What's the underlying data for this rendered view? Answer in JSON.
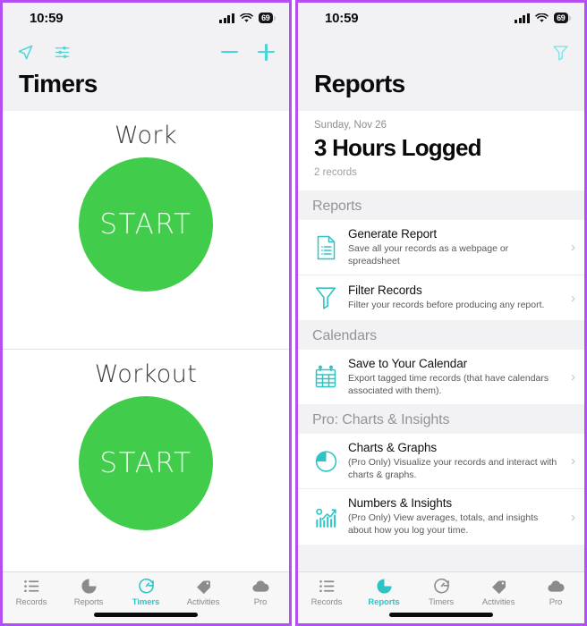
{
  "accent": {
    "teal": "#2ec4c4",
    "teal_light": "#4ad6d6",
    "green": "#41cc4c",
    "frame": "#b44ef5"
  },
  "left_phone": {
    "statusbar": {
      "time": "10:59",
      "battery": "69",
      "signal_icon": "cellular-bars-icon",
      "wifi_icon": "wifi-icon"
    },
    "navbar": {
      "location_icon": "navigation-arrow-icon",
      "filters_icon": "sliders-icon",
      "minus_label": "minus-icon",
      "plus_label": "plus-icon"
    },
    "title": "Timers",
    "timers": [
      {
        "name": "Work",
        "button_label": "START"
      },
      {
        "name": "Workout",
        "button_label": "START"
      }
    ],
    "tabs": [
      {
        "label": "Records",
        "icon": "list-icon",
        "active": false
      },
      {
        "label": "Reports",
        "icon": "pie-chart-icon",
        "active": false
      },
      {
        "label": "Timers",
        "icon": "stopwatch-icon",
        "active": true
      },
      {
        "label": "Activities",
        "icon": "tag-icon",
        "active": false
      },
      {
        "label": "Pro",
        "icon": "cloud-icon",
        "active": false
      }
    ]
  },
  "right_phone": {
    "statusbar": {
      "time": "10:59",
      "battery": "69",
      "signal_icon": "cellular-bars-icon",
      "wifi_icon": "wifi-icon"
    },
    "navbar": {
      "filter_icon": "funnel-icon"
    },
    "title": "Reports",
    "summary": {
      "date": "Sunday, Nov 26",
      "headline": "3 Hours Logged",
      "records": "2 records"
    },
    "sections": [
      {
        "header": "Reports",
        "rows": [
          {
            "icon": "document-report-icon",
            "title": "Generate Report",
            "subtitle": "Save all your records as a webpage or spreadsheet",
            "chevron": "›"
          },
          {
            "icon": "funnel-icon",
            "title": "Filter Records",
            "subtitle": "Filter your records before producing any report.",
            "chevron": "›"
          }
        ]
      },
      {
        "header": "Calendars",
        "rows": [
          {
            "icon": "calendar-icon",
            "title": "Save to Your Calendar",
            "subtitle": "Export tagged time records (that have calendars associated with them).",
            "chevron": "›"
          }
        ]
      },
      {
        "header": "Pro: Charts & Insights",
        "rows": [
          {
            "icon": "pie-chart-icon",
            "title": "Charts & Graphs",
            "subtitle": "(Pro Only) Visualize your records and interact with charts & graphs.",
            "chevron": "›"
          },
          {
            "icon": "bar-chart-trend-icon",
            "title": "Numbers & Insights",
            "subtitle": "(Pro Only) View averages, totals, and insights about how you log your time.",
            "chevron": "›"
          }
        ]
      }
    ],
    "tabs": [
      {
        "label": "Records",
        "icon": "list-icon",
        "active": false
      },
      {
        "label": "Reports",
        "icon": "pie-chart-icon",
        "active": true
      },
      {
        "label": "Timers",
        "icon": "stopwatch-icon",
        "active": false
      },
      {
        "label": "Activities",
        "icon": "tag-icon",
        "active": false
      },
      {
        "label": "Pro",
        "icon": "cloud-icon",
        "active": false
      }
    ]
  }
}
